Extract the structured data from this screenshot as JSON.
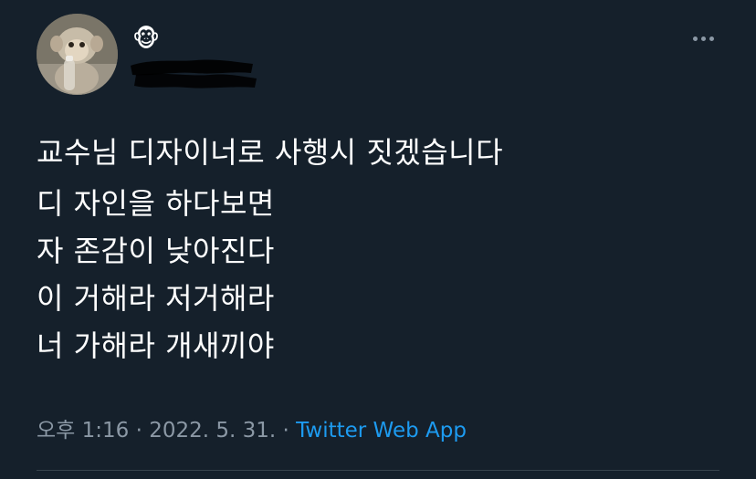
{
  "tweet": {
    "display_name": "🐵",
    "body_lines": [
      "교수님 디자이너로 사행시 짓겠습니다",
      "디 자인을 하다보면",
      "자 존감이 낮아진다",
      "이 거해라 저거해라",
      "너 가해라 개새끼야"
    ],
    "time": "오후 1:16",
    "separator": " · ",
    "date": "2022. 5. 31.",
    "source": "Twitter Web App"
  },
  "icons": {
    "avatar": "monkey-avatar",
    "more": "more-horizontal-icon"
  },
  "colors": {
    "background": "#15202b",
    "text": "#ffffff",
    "secondary_text": "#8b98a5",
    "link": "#1d9bf0"
  }
}
